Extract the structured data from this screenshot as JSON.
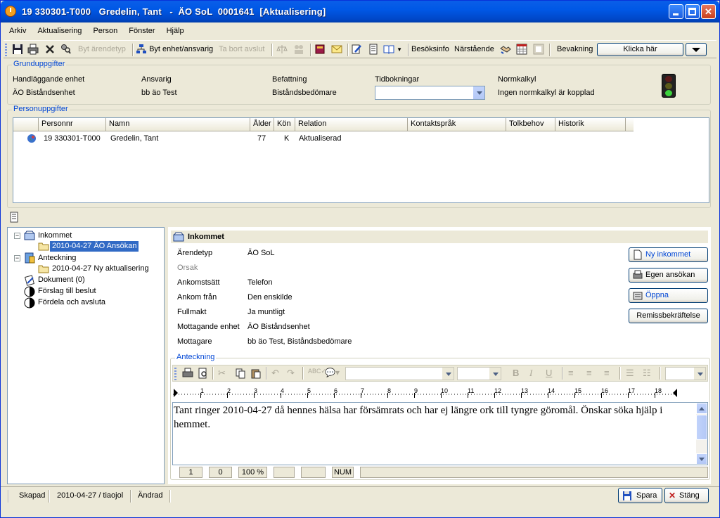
{
  "window": {
    "title": "19 330301-T000   Gredelin, Tant   -  ÄO SoL  0001641  [Aktualisering]"
  },
  "menu": [
    "Arkiv",
    "Aktualisering",
    "Person",
    "Fönster",
    "Hjälp"
  ],
  "toolbar": {
    "byt_arendetyp": "Byt ärendetyp",
    "byt_enhet": "Byt enhet/ansvarig",
    "ta_bort_avslut": "Ta bort avslut",
    "besoksinfo": "Besöksinfo",
    "narstaende": "Närstående",
    "bevakning": "Bevakning",
    "klicka_har": "Klicka här"
  },
  "grunduppgifter": {
    "legend": "Grunduppgifter",
    "handl_label": "Handläggande enhet",
    "handl_value": "ÄO Biståndsenhet",
    "ansvarig_label": "Ansvarig",
    "ansvarig_value": "bb äo Test",
    "befattning_label": "Befattning",
    "befattning_value": "Biståndsbedömare",
    "tidbokningar_label": "Tidbokningar",
    "tidbokningar_value": "",
    "normkalkyl_label": "Normkalkyl",
    "normkalkyl_value": "Ingen normkalkyl är kopplad",
    "traffic_light_colors": {
      "red": "#5a1a1a",
      "yellow": "#5a5a1a",
      "green": "#3cd23c"
    }
  },
  "personuppgifter": {
    "legend": "Personuppgifter",
    "columns": [
      "Personnr",
      "Namn",
      "Ålder",
      "Kön",
      "Relation",
      "Kontaktspråk",
      "Tolkbehov",
      "Historik"
    ],
    "rows": [
      {
        "personnr": "19 330301-T000",
        "namn": "Gredelin, Tant",
        "alder": "77",
        "kon": "K",
        "relation": "Aktualiserad",
        "kontaktsprak": "",
        "tolkbehov": "",
        "historik": ""
      }
    ]
  },
  "tree": {
    "items": [
      {
        "label": "Inkommet"
      },
      {
        "label": "2010-04-27 ÄO Ansökan"
      },
      {
        "label": "Anteckning"
      },
      {
        "label": "2010-04-27 Ny aktualisering"
      },
      {
        "label": "Dokument (0)"
      },
      {
        "label": "Förslag till beslut"
      },
      {
        "label": "Fördela och avsluta"
      }
    ]
  },
  "detail": {
    "header": "Inkommet",
    "fields": [
      {
        "label": "Ärendetyp",
        "value": "ÄO SoL"
      },
      {
        "label": "Orsak",
        "value": ""
      },
      {
        "label": "Ankomstsätt",
        "value": "Telefon"
      },
      {
        "label": "Ankom från",
        "value": "Den enskilde"
      },
      {
        "label": "Fullmakt",
        "value": "Ja muntligt"
      },
      {
        "label": "Mottagande enhet",
        "value": "ÄO Biståndsenhet"
      },
      {
        "label": "Mottagare",
        "value": "bb äo Test, Biståndsbedömare"
      }
    ],
    "buttons": {
      "ny_inkommet": "Ny inkommet",
      "egen_ansokan": "Egen ansökan",
      "oppna": "Öppna",
      "remiss": "Remissbekräftelse"
    }
  },
  "anteckning": {
    "legend": "Anteckning",
    "text": "Tant ringer 2010-04-27 då hennes hälsa har försämrats och har ej längre ork till tyngre göromål. Önskar söka hjälp i hemmet.",
    "ruler_numbers": [
      "1",
      "2",
      "3",
      "4",
      "5",
      "6",
      "7",
      "8",
      "9",
      "10",
      "11",
      "12",
      "13",
      "14",
      "15",
      "16",
      "17",
      "18"
    ],
    "status": {
      "line": "1",
      "col": "0",
      "zoom": "100 %",
      "num": "NUM"
    }
  },
  "statusbar": {
    "skapad": "Skapad",
    "skapad_value": "2010-04-27 / tiaojol",
    "andrad": "Ändrad",
    "spara": "Spara",
    "stang": "Stäng"
  }
}
